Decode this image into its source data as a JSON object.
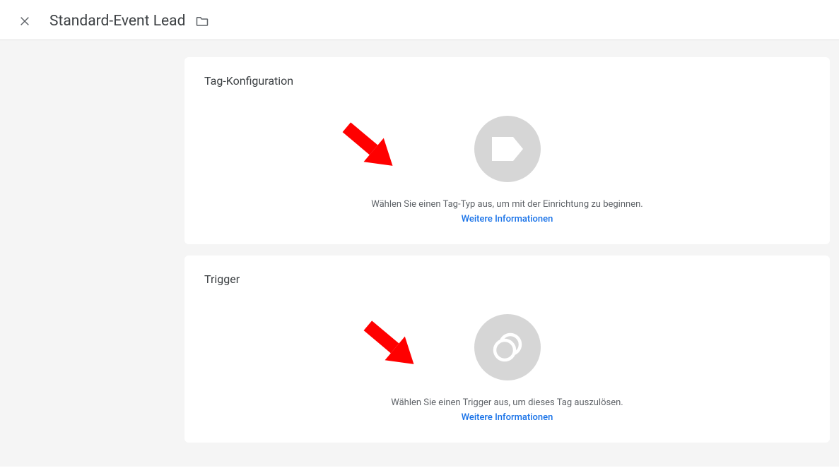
{
  "header": {
    "title": "Standard-Event Lead"
  },
  "cards": {
    "tag": {
      "title": "Tag-Konfiguration",
      "prompt": "Wählen Sie einen Tag-Typ aus, um mit der Einrichtung zu beginnen.",
      "link": "Weitere Informationen"
    },
    "trigger": {
      "title": "Trigger",
      "prompt": "Wählen Sie einen Trigger aus, um dieses Tag auszulösen.",
      "link": "Weitere Informationen"
    }
  }
}
